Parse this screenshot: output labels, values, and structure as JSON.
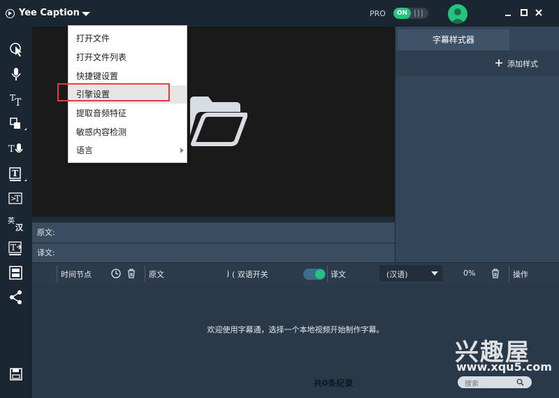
{
  "app": {
    "title": "Yee Caption",
    "pro_label": "PRO",
    "pro_toggle": "ON"
  },
  "menu": {
    "items": [
      {
        "label": "打开文件"
      },
      {
        "label": "打开文件列表"
      },
      {
        "label": "快捷键设置"
      },
      {
        "label": "引擎设置"
      },
      {
        "label": "提取音频特征"
      },
      {
        "label": "敏感内容检测"
      },
      {
        "label": "语言"
      }
    ]
  },
  "style_panel": {
    "tab": "字幕样式器",
    "add_style": "添加样式"
  },
  "editor": {
    "source_label": "原文:",
    "translation_label": "译文:"
  },
  "table": {
    "col_time": "时间节点",
    "col_source": "原文",
    "bilingual_switch": "( 双语开关",
    "bilingual_prefix": "j",
    "col_translation": "译文",
    "language_select": "(汉语)",
    "progress": "0%",
    "col_action": "操作"
  },
  "list": {
    "welcome": "欢迎使用字幕通，选择一个本地视频开始制作字幕。",
    "record_count": "共0条纪录",
    "search_placeholder": "搜索"
  },
  "watermark": {
    "text": "兴趣屋",
    "url": "www.xqu5.com"
  },
  "colors": {
    "accent": "#22c47f",
    "highlight_box": "#e63b3b"
  }
}
